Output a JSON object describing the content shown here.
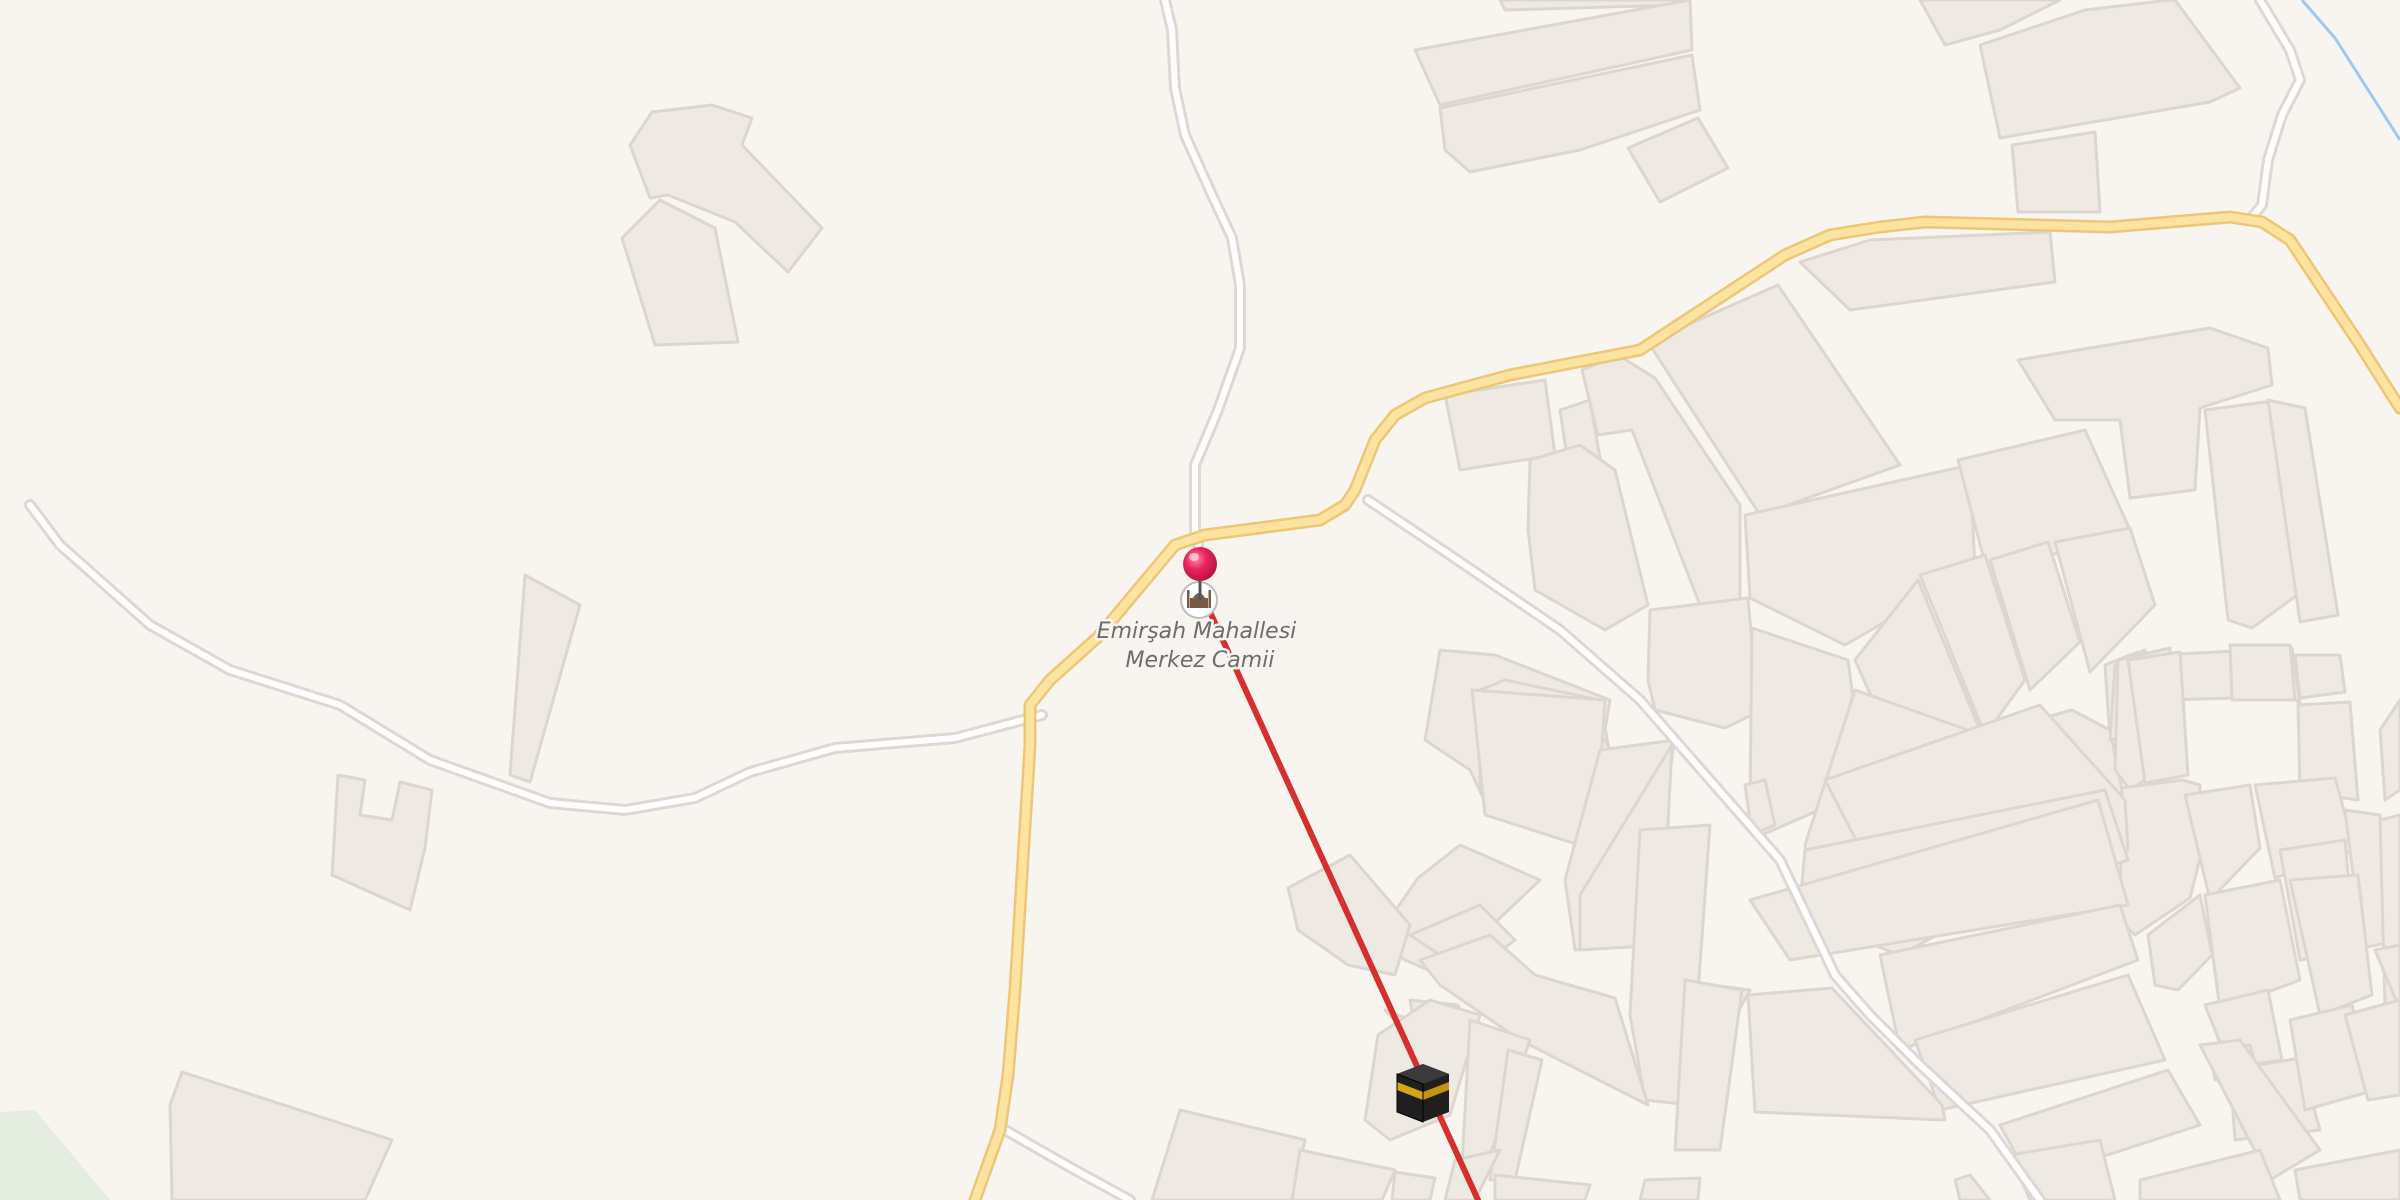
{
  "map": {
    "colors": {
      "background": "#f8f5f1",
      "building_fill": "#efe9e3",
      "building_shadow": "#ddd6cf",
      "minor_road": "#ffffff",
      "minor_road_casing": "#dcd8d3",
      "main_road": "#fde3a0",
      "main_road_casing": "#eec677",
      "qibla_line": "#d62f2f",
      "marker": "#e8245c",
      "stream": "#9ec8ef",
      "park": "#e4ede0"
    },
    "poi": {
      "name_line1": "Emirşah Mahallesi",
      "name_line2": "Merkez Camii",
      "category_icon": "mosque-icon"
    },
    "marker_icon": "map-pin-icon",
    "qibla_icon": "kaaba-icon"
  }
}
